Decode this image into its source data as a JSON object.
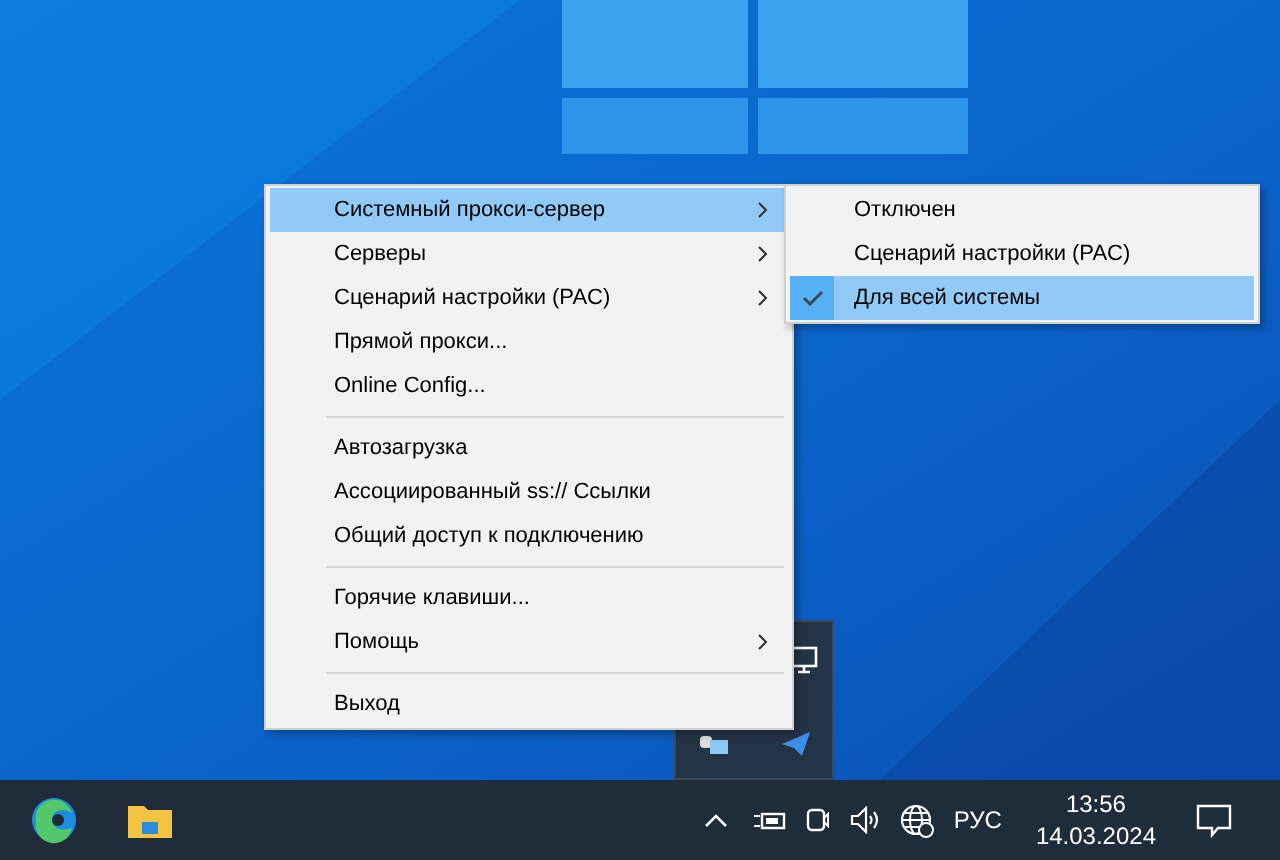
{
  "context_menu": {
    "items": [
      {
        "kind": "item",
        "label": "Системный прокси-сервер",
        "submenu": true,
        "selected": true
      },
      {
        "kind": "item",
        "label": "Серверы",
        "submenu": true,
        "selected": false
      },
      {
        "kind": "item",
        "label": "Сценарий настройки (PAC)",
        "submenu": true,
        "selected": false
      },
      {
        "kind": "item",
        "label": "Прямой прокси...",
        "submenu": false,
        "selected": false
      },
      {
        "kind": "item",
        "label": "Online Config...",
        "submenu": false,
        "selected": false
      },
      {
        "kind": "separator"
      },
      {
        "kind": "item",
        "label": "Автозагрузка",
        "submenu": false,
        "selected": false
      },
      {
        "kind": "item",
        "label": "Ассоциированный ss:// Ссылки",
        "submenu": false,
        "selected": false
      },
      {
        "kind": "item",
        "label": "Общий доступ к подключению",
        "submenu": false,
        "selected": false
      },
      {
        "kind": "separator"
      },
      {
        "kind": "item",
        "label": "Горячие клавиши...",
        "submenu": false,
        "selected": false
      },
      {
        "kind": "item",
        "label": "Помощь",
        "submenu": true,
        "selected": false
      },
      {
        "kind": "separator"
      },
      {
        "kind": "item",
        "label": "Выход",
        "submenu": false,
        "selected": false
      }
    ]
  },
  "submenu": {
    "items": [
      {
        "label": "Отключен",
        "checked": false,
        "selected": false
      },
      {
        "label": "Сценарий настройки (PAC)",
        "checked": false,
        "selected": false
      },
      {
        "label": "Для всей системы",
        "checked": true,
        "selected": true
      }
    ]
  },
  "taskbar": {
    "language": "РУС",
    "time": "13:56",
    "date": "14.03.2024"
  }
}
